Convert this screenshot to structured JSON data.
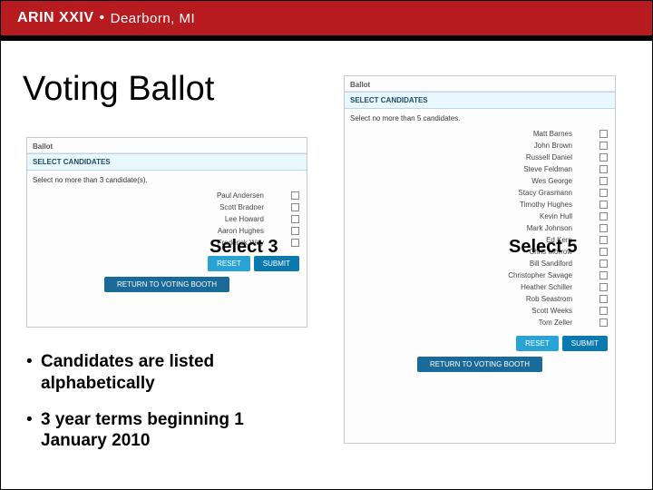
{
  "header": {
    "brand": "ARIN XXIV",
    "separator": "•",
    "location": "Dearborn, MI"
  },
  "title": "Voting Ballot",
  "labels": {
    "select3": "Select 3",
    "select5": "Select 5"
  },
  "bullets": [
    "Candidates are listed alphabetically",
    "3 year terms beginning 1 January 2010"
  ],
  "ballot_small": {
    "heading": "Ballot",
    "section": "SELECT CANDIDATES",
    "instruction": "Select no more than 3 candidate(s).",
    "candidates": [
      "Paul Andersen",
      "Scott Bradner",
      "Lee Howard",
      "Aaron Hughes",
      "Frederick Wey"
    ],
    "buttons": {
      "reset": "RESET",
      "submit": "SUBMIT",
      "return": "RETURN TO VOTING BOOTH"
    }
  },
  "ballot_large": {
    "heading": "Ballot",
    "section": "SELECT CANDIDATES",
    "instruction": "Select no more than 5 candidates.",
    "candidates": [
      "Matt Barnes",
      "John Brown",
      "Russell Daniel",
      "Steve Feldman",
      "Wes George",
      "Stacy Grasmann",
      "Timothy Hughes",
      "Kevin Hull",
      "Mark Johnson",
      "Ed Kern",
      "Chris Morrow",
      "Bill Sandiford",
      "Christopher Savage",
      "Heather Schiller",
      "Rob Seastrom",
      "Scott Weeks",
      "Tom Zeller"
    ],
    "buttons": {
      "reset": "RESET",
      "submit": "SUBMIT",
      "return": "RETURN TO VOTING BOOTH"
    }
  }
}
